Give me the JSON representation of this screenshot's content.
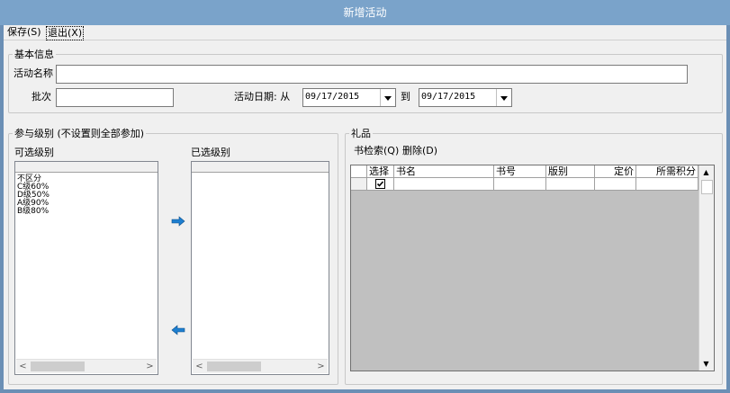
{
  "window": {
    "title": "新增活动"
  },
  "menu": {
    "save": "保存(S)",
    "exit": "退出(X)"
  },
  "basic": {
    "legend": "基本信息",
    "name_label": "活动名称",
    "name_value": "",
    "batch_label": "批次",
    "batch_value": "",
    "date_label": "活动日期: 从",
    "date_from": "09/17/2015",
    "to_label": "到",
    "date_to": "09/17/2015"
  },
  "levels": {
    "legend": "参与级别 (不设置则全部参加)",
    "available_label": "可选级别",
    "selected_label": "已选级别",
    "available_items": [
      "不区分",
      "C级60%",
      "D级50%",
      "A级90%",
      "B级80%"
    ]
  },
  "gifts": {
    "legend": "礼品",
    "search_button": "书检索(Q)",
    "delete_button": "删除(D)",
    "columns": [
      "选择",
      "书名",
      "书号",
      "版别",
      "定价",
      "所需积分"
    ]
  },
  "colors": {
    "title_bar": "#7aa3ca",
    "arrow": "#1e7fd0"
  }
}
